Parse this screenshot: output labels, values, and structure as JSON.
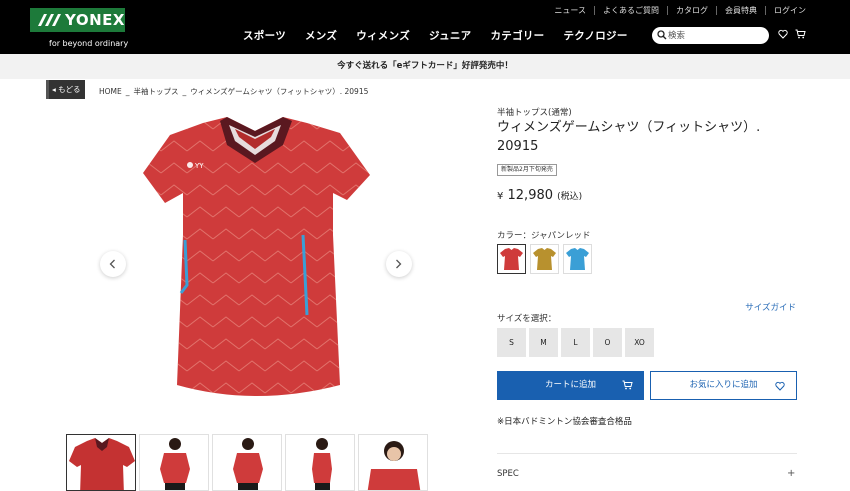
{
  "header": {
    "logo_text": "YONEX",
    "logo_tagline": "for beyond ordinary",
    "util_links": [
      "ニュース",
      "よくあるご質問",
      "カタログ",
      "会員特典",
      "ログイン"
    ],
    "nav_items": [
      "スポーツ",
      "メンズ",
      "ウィメンズ",
      "ジュニア",
      "カテゴリー",
      "テクノロジー"
    ],
    "search_placeholder": "検索"
  },
  "banner": {
    "text": "今すぐ送れる「eギフトカード」好評発売中！"
  },
  "breadcrumb": {
    "back_label": "もどる",
    "items": [
      "HOME",
      "半袖トップス",
      "ウィメンズゲームシャツ（フィットシャツ）. 20915"
    ]
  },
  "product": {
    "category": "半袖トップス(通常)",
    "title": "ウィメンズゲームシャツ（フィットシャツ）. 20915",
    "tag": "新製品2月下旬発売",
    "price_symbol": "¥",
    "price": "12,980",
    "tax_note": "(税込)",
    "color_label": "カラー：ジャパンレッド",
    "colors": [
      "#cf3b3b",
      "#b8912e",
      "#3a9fd6"
    ],
    "size_guide_label": "サイズガイド",
    "size_label": "サイズを選択：",
    "sizes": [
      "S",
      "M",
      "L",
      "O",
      "XO"
    ],
    "cart_label": "カートに追加",
    "fav_label": "お気に入りに追加",
    "note": "※日本バドミントン協会審査合格品",
    "spec_label": "SPEC",
    "spec_toggle": "+"
  },
  "colors": {
    "brand_green": "#1d7a3a",
    "button_blue": "#1960b0",
    "shirt_red": "#cf3b3b"
  }
}
